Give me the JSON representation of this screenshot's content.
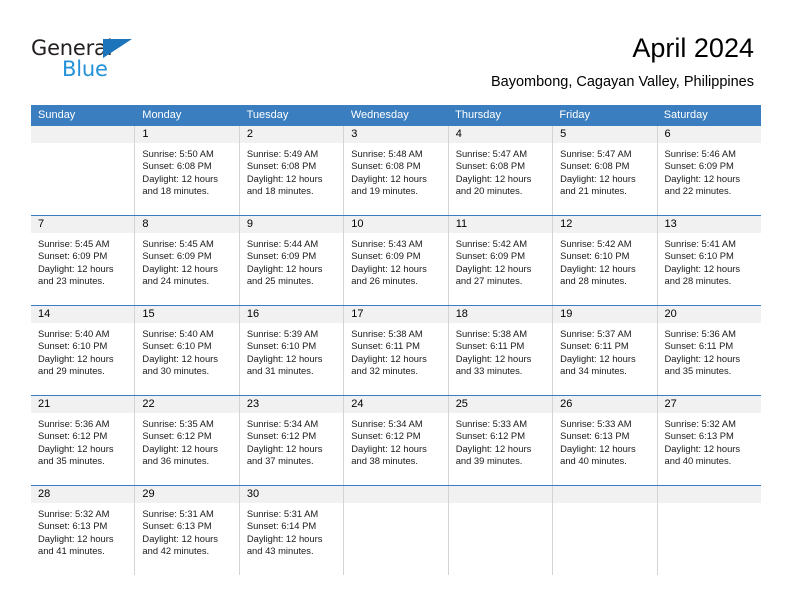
{
  "brand": {
    "name_part1": "General",
    "name_part2": "Blue",
    "triangle_color": "#1c74bb",
    "blue_color": "#2491d9"
  },
  "header": {
    "title": "April 2024",
    "location": "Bayombong, Cagayan Valley, Philippines"
  },
  "theme": {
    "header_blue": "#3a7ebf",
    "day_band_gray": "#f1f1f1",
    "cell_border": "#d4d4d4"
  },
  "calendar": {
    "day_names": [
      "Sunday",
      "Monday",
      "Tuesday",
      "Wednesday",
      "Thursday",
      "Friday",
      "Saturday"
    ],
    "weeks": [
      [
        {
          "day": "",
          "empty": true,
          "sunrise": "",
          "sunset": "",
          "daylight_line1": "",
          "daylight_line2": ""
        },
        {
          "day": "1",
          "empty": false,
          "sunrise": "Sunrise: 5:50 AM",
          "sunset": "Sunset: 6:08 PM",
          "daylight_line1": "Daylight: 12 hours",
          "daylight_line2": "and 18 minutes."
        },
        {
          "day": "2",
          "empty": false,
          "sunrise": "Sunrise: 5:49 AM",
          "sunset": "Sunset: 6:08 PM",
          "daylight_line1": "Daylight: 12 hours",
          "daylight_line2": "and 18 minutes."
        },
        {
          "day": "3",
          "empty": false,
          "sunrise": "Sunrise: 5:48 AM",
          "sunset": "Sunset: 6:08 PM",
          "daylight_line1": "Daylight: 12 hours",
          "daylight_line2": "and 19 minutes."
        },
        {
          "day": "4",
          "empty": false,
          "sunrise": "Sunrise: 5:47 AM",
          "sunset": "Sunset: 6:08 PM",
          "daylight_line1": "Daylight: 12 hours",
          "daylight_line2": "and 20 minutes."
        },
        {
          "day": "5",
          "empty": false,
          "sunrise": "Sunrise: 5:47 AM",
          "sunset": "Sunset: 6:08 PM",
          "daylight_line1": "Daylight: 12 hours",
          "daylight_line2": "and 21 minutes."
        },
        {
          "day": "6",
          "empty": false,
          "sunrise": "Sunrise: 5:46 AM",
          "sunset": "Sunset: 6:09 PM",
          "daylight_line1": "Daylight: 12 hours",
          "daylight_line2": "and 22 minutes."
        }
      ],
      [
        {
          "day": "7",
          "empty": false,
          "sunrise": "Sunrise: 5:45 AM",
          "sunset": "Sunset: 6:09 PM",
          "daylight_line1": "Daylight: 12 hours",
          "daylight_line2": "and 23 minutes."
        },
        {
          "day": "8",
          "empty": false,
          "sunrise": "Sunrise: 5:45 AM",
          "sunset": "Sunset: 6:09 PM",
          "daylight_line1": "Daylight: 12 hours",
          "daylight_line2": "and 24 minutes."
        },
        {
          "day": "9",
          "empty": false,
          "sunrise": "Sunrise: 5:44 AM",
          "sunset": "Sunset: 6:09 PM",
          "daylight_line1": "Daylight: 12 hours",
          "daylight_line2": "and 25 minutes."
        },
        {
          "day": "10",
          "empty": false,
          "sunrise": "Sunrise: 5:43 AM",
          "sunset": "Sunset: 6:09 PM",
          "daylight_line1": "Daylight: 12 hours",
          "daylight_line2": "and 26 minutes."
        },
        {
          "day": "11",
          "empty": false,
          "sunrise": "Sunrise: 5:42 AM",
          "sunset": "Sunset: 6:09 PM",
          "daylight_line1": "Daylight: 12 hours",
          "daylight_line2": "and 27 minutes."
        },
        {
          "day": "12",
          "empty": false,
          "sunrise": "Sunrise: 5:42 AM",
          "sunset": "Sunset: 6:10 PM",
          "daylight_line1": "Daylight: 12 hours",
          "daylight_line2": "and 28 minutes."
        },
        {
          "day": "13",
          "empty": false,
          "sunrise": "Sunrise: 5:41 AM",
          "sunset": "Sunset: 6:10 PM",
          "daylight_line1": "Daylight: 12 hours",
          "daylight_line2": "and 28 minutes."
        }
      ],
      [
        {
          "day": "14",
          "empty": false,
          "sunrise": "Sunrise: 5:40 AM",
          "sunset": "Sunset: 6:10 PM",
          "daylight_line1": "Daylight: 12 hours",
          "daylight_line2": "and 29 minutes."
        },
        {
          "day": "15",
          "empty": false,
          "sunrise": "Sunrise: 5:40 AM",
          "sunset": "Sunset: 6:10 PM",
          "daylight_line1": "Daylight: 12 hours",
          "daylight_line2": "and 30 minutes."
        },
        {
          "day": "16",
          "empty": false,
          "sunrise": "Sunrise: 5:39 AM",
          "sunset": "Sunset: 6:10 PM",
          "daylight_line1": "Daylight: 12 hours",
          "daylight_line2": "and 31 minutes."
        },
        {
          "day": "17",
          "empty": false,
          "sunrise": "Sunrise: 5:38 AM",
          "sunset": "Sunset: 6:11 PM",
          "daylight_line1": "Daylight: 12 hours",
          "daylight_line2": "and 32 minutes."
        },
        {
          "day": "18",
          "empty": false,
          "sunrise": "Sunrise: 5:38 AM",
          "sunset": "Sunset: 6:11 PM",
          "daylight_line1": "Daylight: 12 hours",
          "daylight_line2": "and 33 minutes."
        },
        {
          "day": "19",
          "empty": false,
          "sunrise": "Sunrise: 5:37 AM",
          "sunset": "Sunset: 6:11 PM",
          "daylight_line1": "Daylight: 12 hours",
          "daylight_line2": "and 34 minutes."
        },
        {
          "day": "20",
          "empty": false,
          "sunrise": "Sunrise: 5:36 AM",
          "sunset": "Sunset: 6:11 PM",
          "daylight_line1": "Daylight: 12 hours",
          "daylight_line2": "and 35 minutes."
        }
      ],
      [
        {
          "day": "21",
          "empty": false,
          "sunrise": "Sunrise: 5:36 AM",
          "sunset": "Sunset: 6:12 PM",
          "daylight_line1": "Daylight: 12 hours",
          "daylight_line2": "and 35 minutes."
        },
        {
          "day": "22",
          "empty": false,
          "sunrise": "Sunrise: 5:35 AM",
          "sunset": "Sunset: 6:12 PM",
          "daylight_line1": "Daylight: 12 hours",
          "daylight_line2": "and 36 minutes."
        },
        {
          "day": "23",
          "empty": false,
          "sunrise": "Sunrise: 5:34 AM",
          "sunset": "Sunset: 6:12 PM",
          "daylight_line1": "Daylight: 12 hours",
          "daylight_line2": "and 37 minutes."
        },
        {
          "day": "24",
          "empty": false,
          "sunrise": "Sunrise: 5:34 AM",
          "sunset": "Sunset: 6:12 PM",
          "daylight_line1": "Daylight: 12 hours",
          "daylight_line2": "and 38 minutes."
        },
        {
          "day": "25",
          "empty": false,
          "sunrise": "Sunrise: 5:33 AM",
          "sunset": "Sunset: 6:12 PM",
          "daylight_line1": "Daylight: 12 hours",
          "daylight_line2": "and 39 minutes."
        },
        {
          "day": "26",
          "empty": false,
          "sunrise": "Sunrise: 5:33 AM",
          "sunset": "Sunset: 6:13 PM",
          "daylight_line1": "Daylight: 12 hours",
          "daylight_line2": "and 40 minutes."
        },
        {
          "day": "27",
          "empty": false,
          "sunrise": "Sunrise: 5:32 AM",
          "sunset": "Sunset: 6:13 PM",
          "daylight_line1": "Daylight: 12 hours",
          "daylight_line2": "and 40 minutes."
        }
      ],
      [
        {
          "day": "28",
          "empty": false,
          "sunrise": "Sunrise: 5:32 AM",
          "sunset": "Sunset: 6:13 PM",
          "daylight_line1": "Daylight: 12 hours",
          "daylight_line2": "and 41 minutes."
        },
        {
          "day": "29",
          "empty": false,
          "sunrise": "Sunrise: 5:31 AM",
          "sunset": "Sunset: 6:13 PM",
          "daylight_line1": "Daylight: 12 hours",
          "daylight_line2": "and 42 minutes."
        },
        {
          "day": "30",
          "empty": false,
          "sunrise": "Sunrise: 5:31 AM",
          "sunset": "Sunset: 6:14 PM",
          "daylight_line1": "Daylight: 12 hours",
          "daylight_line2": "and 43 minutes."
        },
        {
          "day": "",
          "empty": true,
          "sunrise": "",
          "sunset": "",
          "daylight_line1": "",
          "daylight_line2": ""
        },
        {
          "day": "",
          "empty": true,
          "sunrise": "",
          "sunset": "",
          "daylight_line1": "",
          "daylight_line2": ""
        },
        {
          "day": "",
          "empty": true,
          "sunrise": "",
          "sunset": "",
          "daylight_line1": "",
          "daylight_line2": ""
        },
        {
          "day": "",
          "empty": true,
          "sunrise": "",
          "sunset": "",
          "daylight_line1": "",
          "daylight_line2": ""
        }
      ]
    ]
  }
}
